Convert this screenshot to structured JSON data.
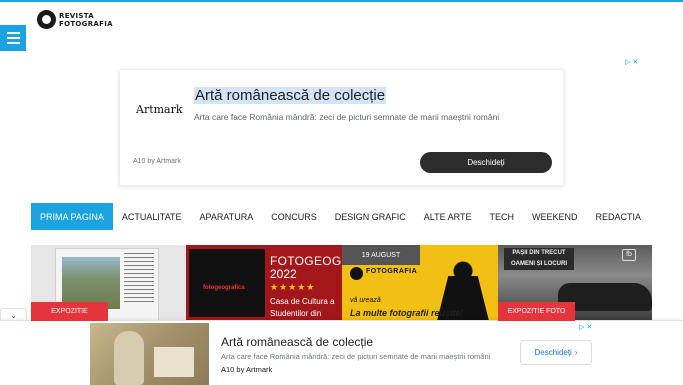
{
  "site": {
    "logo_line1": "REVISTA",
    "logo_line2": "FOTOGRAFIA",
    "accent_color": "#1aa3e0"
  },
  "top_ad": {
    "brand": "Artmark",
    "headline": "Artă românească de colecție",
    "description": "Arta care face România mândră: zeci de picturi semnate de marii maeștrii români",
    "ad_by": "A10 by Artmark",
    "cta": "Deschideți",
    "adchoices_icon": "▷ ✕"
  },
  "nav": {
    "items": [
      "PRIMA PAGINA",
      "ACTUALITATE",
      "APARATURA",
      "CONCURS",
      "DESIGN GRAFIC",
      "ALTE ARTE",
      "TECH",
      "WEEKEND",
      "REDACTIA"
    ],
    "active_index": 0
  },
  "cards": {
    "card1": {
      "badge": "EXPOZITIE"
    },
    "card2": {
      "title": "FOTOGEOGRA",
      "year": "2022",
      "stars": "★★★★★",
      "text": "Casa de Cultura a Studentilor din",
      "inner_label": "fotogeografica"
    },
    "card3": {
      "date": "19 AUGUST",
      "brand": "FOTOGRAFIA",
      "slogan1": "vă urează",
      "slogan2": "La multe fotografii reușite!"
    },
    "card4": {
      "badge": "EXPOZITIE FOTO",
      "sign_line1": "PAȘII DIN TRECUT",
      "sign_line2": "OAMENI ȘI LOCURI",
      "fb_icon": "fb"
    }
  },
  "bottom_ad": {
    "headline": "Artă românească de colecție",
    "description": "Arta care face România mândră: zeci de picturi semnate de marii maeștrii români",
    "ad_by": "A10 by Artmark",
    "cta": "Deschideți",
    "cta_icon": "›",
    "adchoices_icon": "▷ ✕",
    "collapse_icon": "⌄"
  }
}
